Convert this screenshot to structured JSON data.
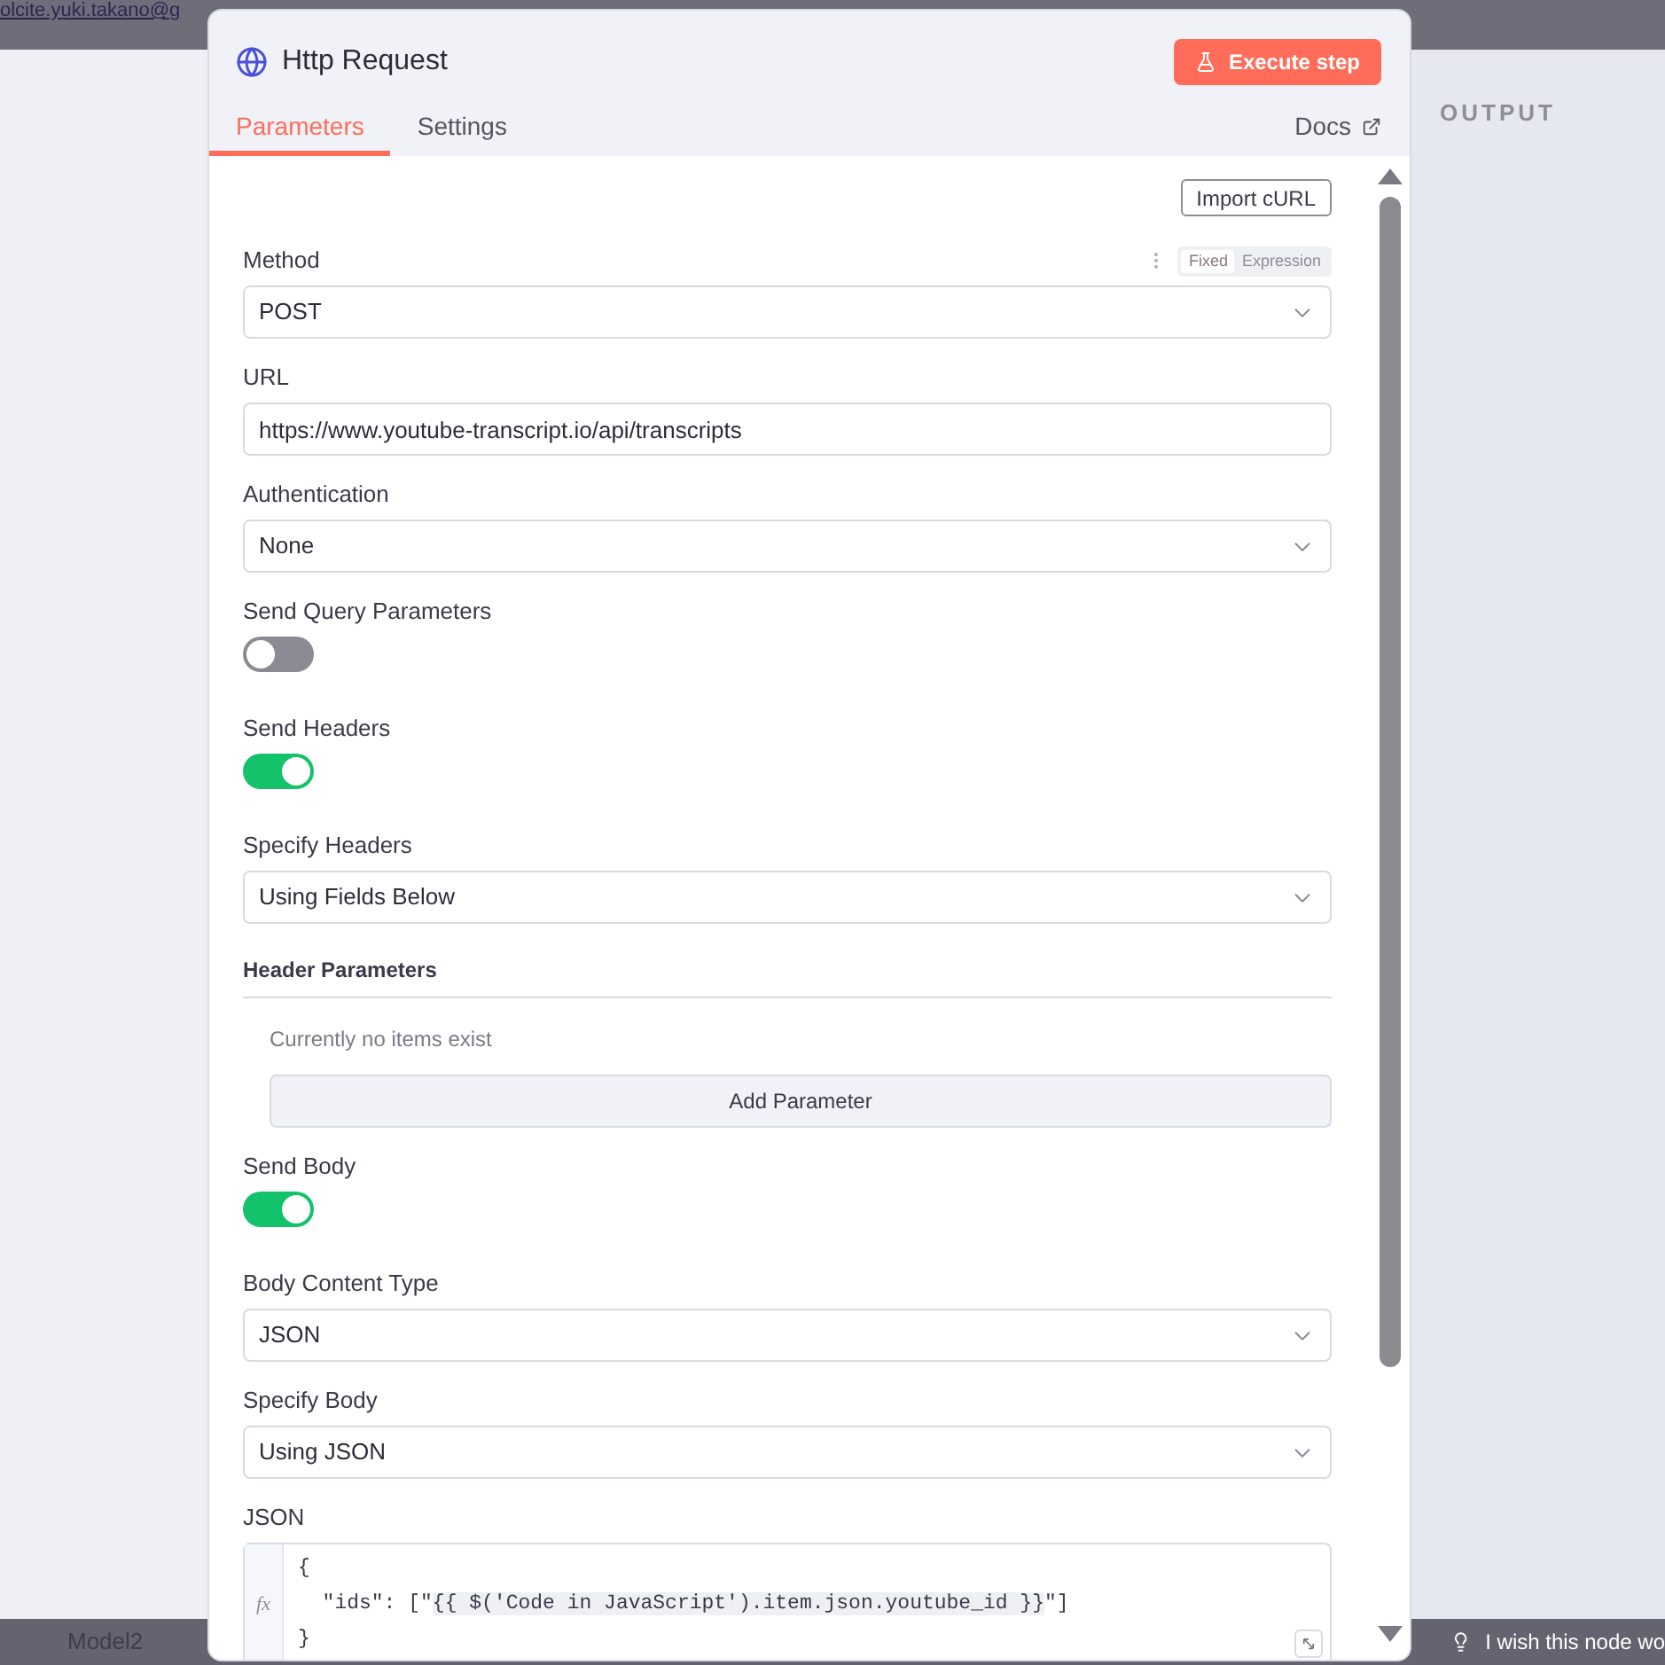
{
  "background": {
    "email": "olcite.yuki.takano@g",
    "output_label": "OUTPUT",
    "node_label": "Model2",
    "feedback": "I wish this node wo"
  },
  "panel": {
    "title": "Http Request",
    "execute_button": "Execute step",
    "tabs": [
      {
        "label": "Parameters",
        "selected": true
      },
      {
        "label": "Settings",
        "selected": false
      }
    ],
    "docs": "Docs",
    "import_button": "Import cURL",
    "fields": [
      {
        "kind": "select",
        "label": "Method",
        "value": "POST",
        "mode_toggle": [
          {
            "label": "Fixed",
            "selected": true
          },
          {
            "label": "Expression",
            "selected": false
          }
        ]
      },
      {
        "kind": "text",
        "label": "URL",
        "value": "https://www.youtube-transcript.io/api/transcripts"
      },
      {
        "kind": "select",
        "label": "Authentication",
        "value": "None"
      },
      {
        "kind": "switch",
        "label": "Send Query Parameters",
        "on": false
      },
      {
        "kind": "switch",
        "label": "Send Headers",
        "on": true
      },
      {
        "kind": "select",
        "label": "Specify Headers",
        "value": "Using Fields Below"
      },
      {
        "kind": "collection",
        "label": "Header Parameters",
        "empty_text": "Currently no items exist",
        "button": "Add Parameter"
      },
      {
        "kind": "switch",
        "label": "Send Body",
        "on": true
      },
      {
        "kind": "select",
        "label": "Body Content Type",
        "value": "JSON"
      },
      {
        "kind": "select",
        "label": "Specify Body",
        "value": "Using JSON"
      },
      {
        "kind": "code",
        "label": "JSON",
        "prefix": "fx",
        "lines": [
          [
            {
              "kind": "plain",
              "text": "{"
            }
          ],
          [
            {
              "kind": "plain",
              "text": "  \"ids\": [\""
            },
            {
              "kind": "expression",
              "text": "{{ $('Code in JavaScript').item.json.youtube_id }}"
            },
            {
              "kind": "plain",
              "text": "\"]"
            }
          ],
          [
            {
              "kind": "plain",
              "text": "}"
            }
          ]
        ]
      }
    ]
  }
}
